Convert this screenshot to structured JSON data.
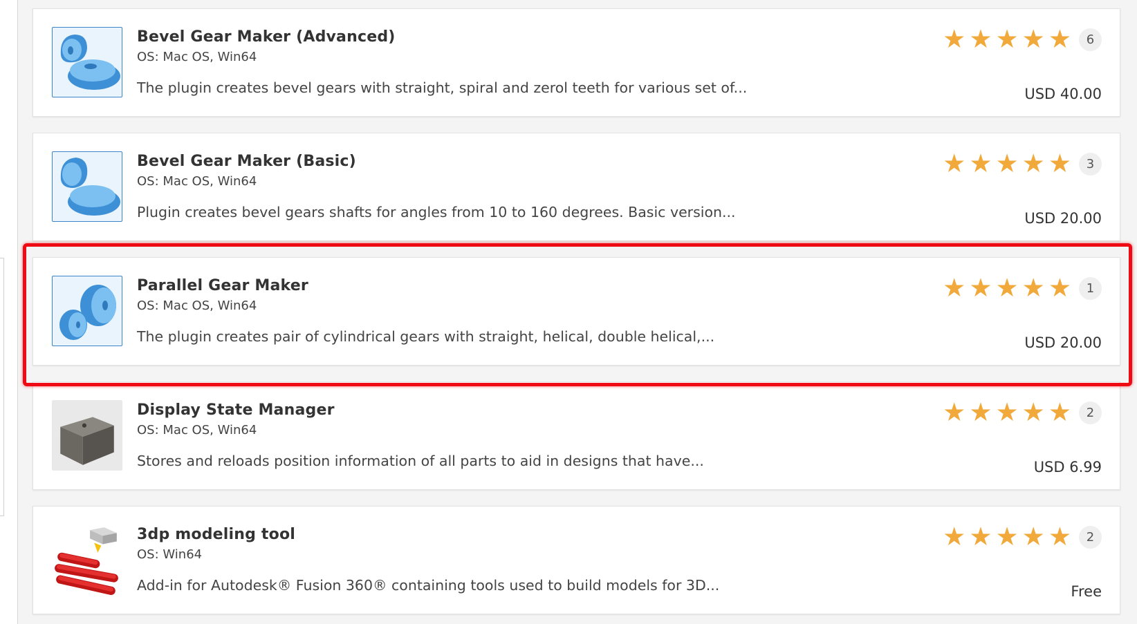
{
  "items": [
    {
      "title": "Bevel Gear Maker (Advanced)",
      "os": "OS: Mac OS, Win64",
      "description": "The plugin creates bevel gears with straight, spiral and zerol teeth for various set of...",
      "rating": 5,
      "review_count": "6",
      "price": "USD 40.00",
      "icon": "bevel-gear-icon"
    },
    {
      "title": "Bevel Gear Maker (Basic)",
      "os": "OS: Mac OS, Win64",
      "description": "Plugin creates bevel gears shafts for angles from 10 to 160 degrees. Basic version...",
      "rating": 5,
      "review_count": "3",
      "price": "USD 20.00",
      "icon": "bevel-gear-icon"
    },
    {
      "title": "Parallel Gear Maker",
      "os": "OS: Mac OS, Win64",
      "description": "The plugin creates pair of cylindrical gears with straight, helical, double helical,...",
      "rating": 5,
      "review_count": "1",
      "price": "USD 20.00",
      "icon": "parallel-gear-icon"
    },
    {
      "title": "Display State Manager",
      "os": "OS: Mac OS, Win64",
      "description": "Stores and reloads position information of all parts to aid in designs that have...",
      "rating": 5,
      "review_count": "2",
      "price": "USD 6.99",
      "icon": "box-icon"
    },
    {
      "title": "3dp modeling tool",
      "os": "OS: Win64",
      "description": "Add-in for Autodesk® Fusion 360® containing tools used to build models for 3D...",
      "rating": 5,
      "review_count": "2",
      "price": "Free",
      "icon": "3d-printer-nozzle-icon"
    }
  ],
  "star_glyph": "★",
  "colors": {
    "star": "#f1a93b",
    "highlight": "#ee0b14",
    "thumb_border": "#3a86c8",
    "gear_blue": "#5aa9e6"
  }
}
